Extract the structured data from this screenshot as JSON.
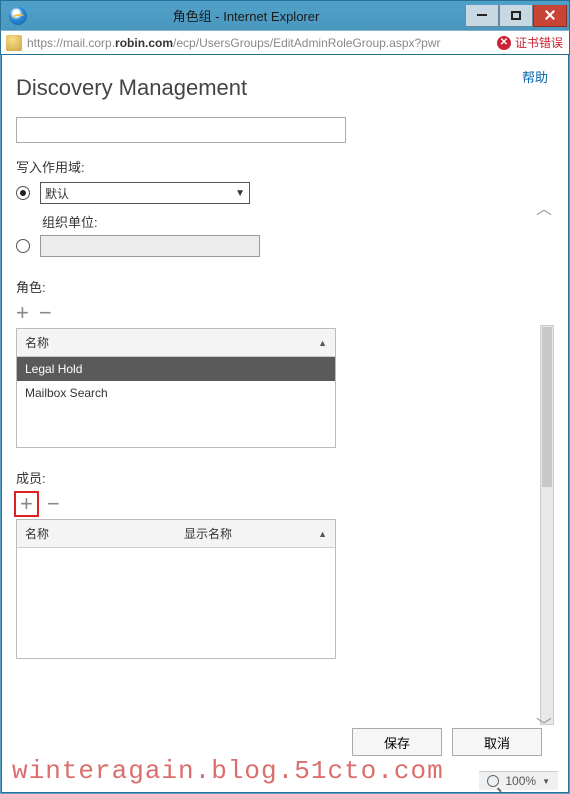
{
  "window": {
    "title": "角色组 - Internet Explorer"
  },
  "addressbar": {
    "prefix": "https://mail.corp.",
    "host": "robin.com",
    "path": "/ecp/UsersGroups/EditAdminRoleGroup.aspx?pwr",
    "cert_error": "证书错误"
  },
  "page": {
    "help": "帮助",
    "title": "Discovery Management"
  },
  "scope": {
    "label": "写入作用域:",
    "default_option": "默认",
    "org_unit_label": "组织单位:"
  },
  "roles": {
    "label": "角色:",
    "col_name": "名称",
    "items": [
      "Legal Hold",
      "Mailbox Search"
    ]
  },
  "members": {
    "label": "成员:",
    "col_name": "名称",
    "col_display": "显示名称"
  },
  "buttons": {
    "save": "保存",
    "cancel": "取消"
  },
  "zoom": {
    "level": "100%"
  },
  "watermark": "winteragain.blog.51cto.com"
}
